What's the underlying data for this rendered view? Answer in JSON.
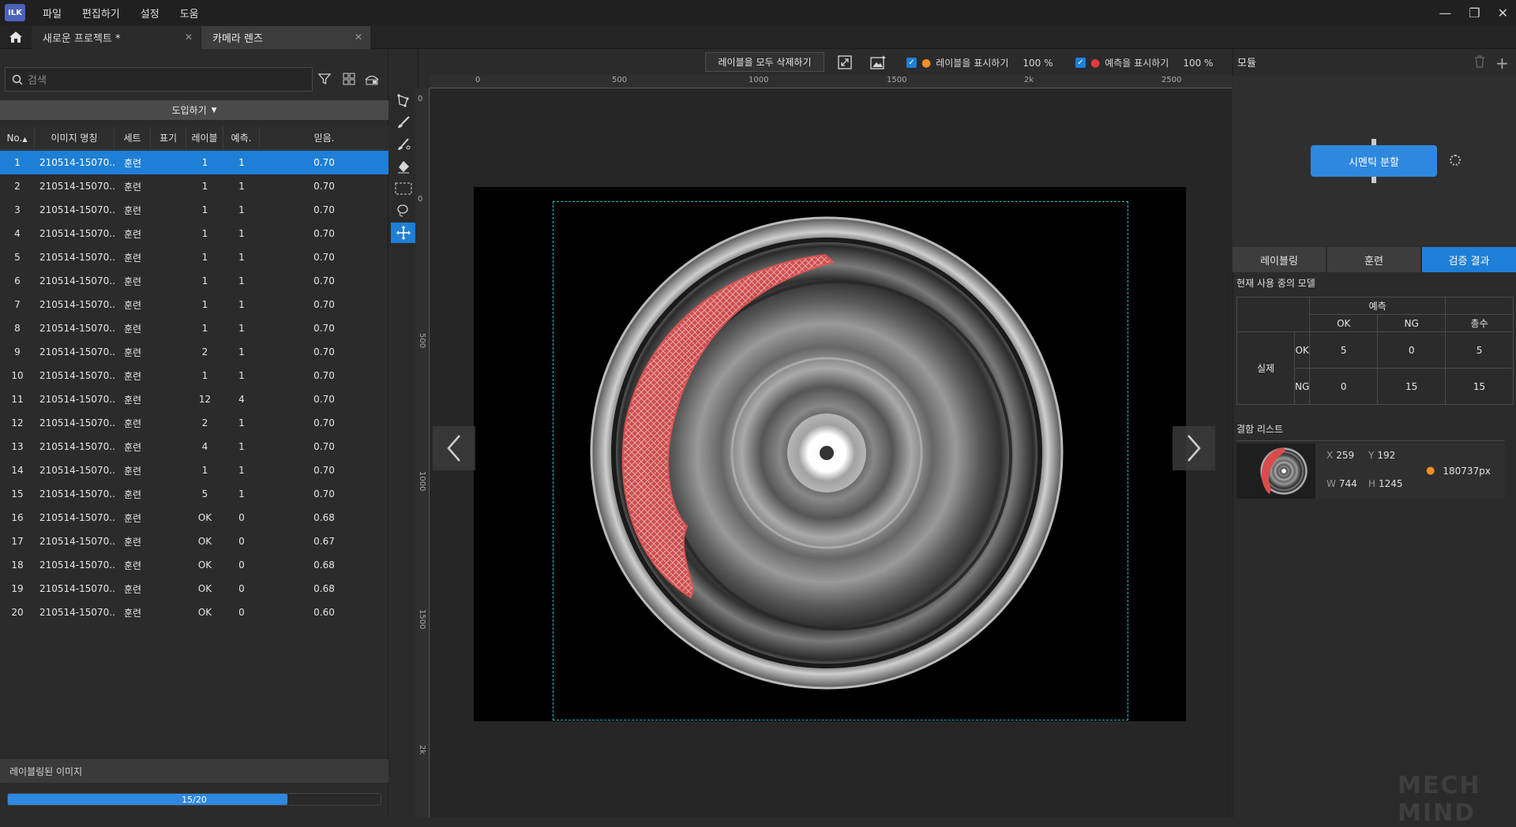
{
  "app": {
    "logo": "ILK"
  },
  "menu": [
    "파일",
    "편집하기",
    "설정",
    "도움"
  ],
  "tabs": [
    {
      "label": "새로운 프로젝트 *"
    },
    {
      "label": "카메라 렌즈"
    }
  ],
  "left": {
    "search_placeholder": "검색",
    "import_label": "도입하기",
    "columns": [
      "No.",
      "이미지 명칭",
      "세트",
      "표기",
      "레이블",
      "예측.",
      "믿음."
    ],
    "rows": [
      {
        "no": "1",
        "name": "210514-15070...",
        "set": "훈련",
        "mark": "",
        "label": "1",
        "pred": "1",
        "conf": "0.70"
      },
      {
        "no": "2",
        "name": "210514-15070...",
        "set": "훈련",
        "mark": "",
        "label": "1",
        "pred": "1",
        "conf": "0.70"
      },
      {
        "no": "3",
        "name": "210514-15070...",
        "set": "훈련",
        "mark": "",
        "label": "1",
        "pred": "1",
        "conf": "0.70"
      },
      {
        "no": "4",
        "name": "210514-15070...",
        "set": "훈련",
        "mark": "",
        "label": "1",
        "pred": "1",
        "conf": "0.70"
      },
      {
        "no": "5",
        "name": "210514-15070...",
        "set": "훈련",
        "mark": "",
        "label": "1",
        "pred": "1",
        "conf": "0.70"
      },
      {
        "no": "6",
        "name": "210514-15070...",
        "set": "훈련",
        "mark": "",
        "label": "1",
        "pred": "1",
        "conf": "0.70"
      },
      {
        "no": "7",
        "name": "210514-15070...",
        "set": "훈련",
        "mark": "",
        "label": "1",
        "pred": "1",
        "conf": "0.70"
      },
      {
        "no": "8",
        "name": "210514-15070...",
        "set": "훈련",
        "mark": "",
        "label": "1",
        "pred": "1",
        "conf": "0.70"
      },
      {
        "no": "9",
        "name": "210514-15070...",
        "set": "훈련",
        "mark": "",
        "label": "2",
        "pred": "1",
        "conf": "0.70"
      },
      {
        "no": "10",
        "name": "210514-15070...",
        "set": "훈련",
        "mark": "",
        "label": "1",
        "pred": "1",
        "conf": "0.70"
      },
      {
        "no": "11",
        "name": "210514-15070...",
        "set": "훈련",
        "mark": "",
        "label": "12",
        "pred": "4",
        "conf": "0.70"
      },
      {
        "no": "12",
        "name": "210514-15070...",
        "set": "훈련",
        "mark": "",
        "label": "2",
        "pred": "1",
        "conf": "0.70"
      },
      {
        "no": "13",
        "name": "210514-15070...",
        "set": "훈련",
        "mark": "",
        "label": "4",
        "pred": "1",
        "conf": "0.70"
      },
      {
        "no": "14",
        "name": "210514-15070...",
        "set": "훈련",
        "mark": "",
        "label": "1",
        "pred": "1",
        "conf": "0.70"
      },
      {
        "no": "15",
        "name": "210514-15070...",
        "set": "훈련",
        "mark": "",
        "label": "5",
        "pred": "1",
        "conf": "0.70"
      },
      {
        "no": "16",
        "name": "210514-15070...",
        "set": "훈련",
        "mark": "",
        "label": "OK",
        "pred": "0",
        "conf": "0.68"
      },
      {
        "no": "17",
        "name": "210514-15070...",
        "set": "훈련",
        "mark": "",
        "label": "OK",
        "pred": "0",
        "conf": "0.67"
      },
      {
        "no": "18",
        "name": "210514-15070...",
        "set": "훈련",
        "mark": "",
        "label": "OK",
        "pred": "0",
        "conf": "0.68"
      },
      {
        "no": "19",
        "name": "210514-15070...",
        "set": "훈련",
        "mark": "",
        "label": "OK",
        "pred": "0",
        "conf": "0.68"
      },
      {
        "no": "20",
        "name": "210514-15070...",
        "set": "훈련",
        "mark": "",
        "label": "OK",
        "pred": "0",
        "conf": "0.60"
      }
    ],
    "labeled_title": "레이블링된 이미지",
    "progress_text": "15/20",
    "progress_fraction": 0.75
  },
  "canvas": {
    "delete_all_label": "레이블을 모두 삭제하기",
    "show_labels": "레이블을 표시하기",
    "label_opacity": "100 %",
    "show_pred": "예측을 표시하기",
    "pred_opacity": "100 %",
    "ruler_h": [
      "0",
      "500",
      "1000",
      "1500",
      "2k",
      "2500"
    ],
    "ruler_v": [
      "0",
      "0",
      "500",
      "1000",
      "1500",
      "2k"
    ]
  },
  "right": {
    "module_title": "모듈",
    "module_button": "시멘틱 분할",
    "tabs": [
      "레이블링",
      "훈련",
      "검증 결과"
    ],
    "current_model": "현재 사용 중의 모델",
    "matrix": {
      "pred_header": "예측",
      "cols": [
        "OK",
        "NG",
        "총수"
      ],
      "actual_header": "실제",
      "rows": [
        {
          "label": "OK",
          "values": [
            "5",
            "0",
            "5"
          ]
        },
        {
          "label": "NG",
          "values": [
            "0",
            "15",
            "15"
          ]
        }
      ]
    },
    "defect_title": "결함 리스트",
    "defect": {
      "x_label": "X",
      "x": "259",
      "y_label": "Y",
      "y": "192",
      "w_label": "W",
      "w": "744",
      "h_label": "H",
      "h": "1245",
      "area": "180737px"
    }
  },
  "watermark": "MECH MIND",
  "colors": {
    "accent": "#1e7fd6",
    "label": "#e04545",
    "bbox": "#19c3c9"
  }
}
